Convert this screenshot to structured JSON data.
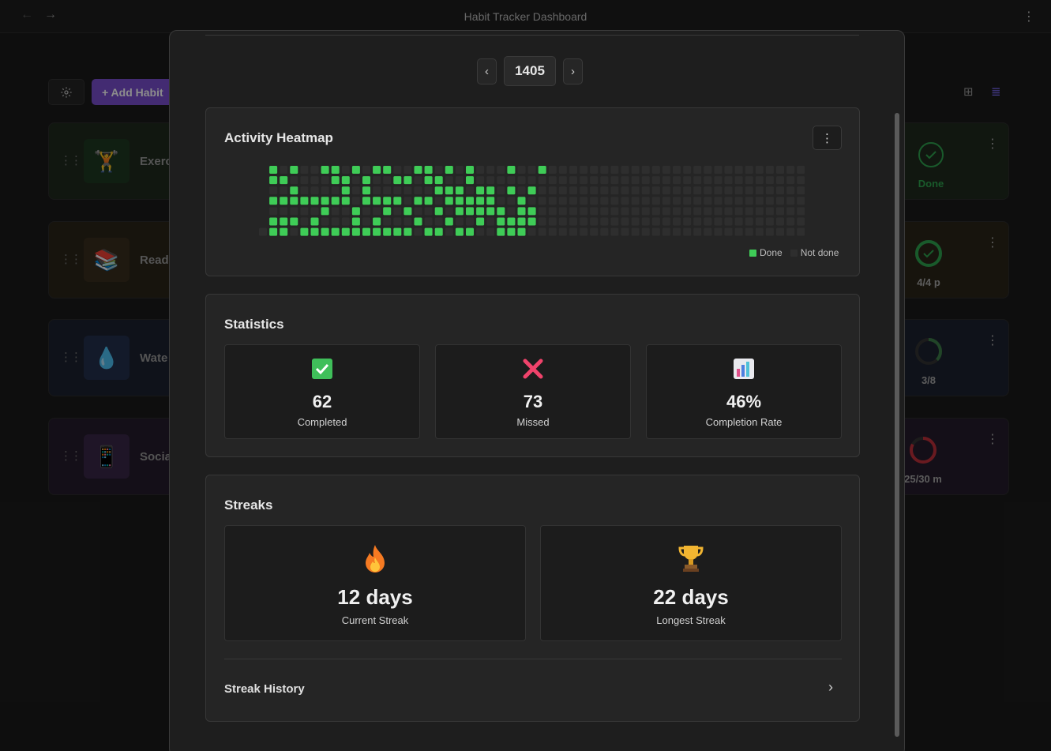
{
  "window": {
    "title": "Habit Tracker Dashboard",
    "back_icon": "arrow-left-icon",
    "forward_icon": "arrow-right-icon",
    "menu_icon": "vertical-dots-icon"
  },
  "toolbar": {
    "settings_icon": "gear-icon",
    "add_label": "+ Add Habit",
    "view_grid_icon": "grid-icon",
    "view_list_icon": "list-icon"
  },
  "habits": [
    {
      "name": "Exerc",
      "emoji": "🏋️",
      "status": "Done",
      "status_color": "#2fa44f",
      "tint": "#1f2a1e"
    },
    {
      "name": "Readi",
      "emoji": "📚",
      "status": "4/4 p",
      "status_color": "#2fa44f",
      "tint": "#2a2519"
    },
    {
      "name": "Wate",
      "emoji": "💧",
      "status": "3/8",
      "status_color": "#3d7f4a",
      "tint": "#1d2130",
      "progress": 0.375
    },
    {
      "name": "Socia",
      "emoji": "📱",
      "status": "25/30 m",
      "status_color": "#c0313b",
      "tint": "#261d2c",
      "progress": 0.83
    }
  ],
  "modal": {
    "year": "1405",
    "prev_label": "‹",
    "next_label": "›",
    "heatmap": {
      "title": "Activity Heatmap",
      "menu_icon": "vertical-dots-icon",
      "legend_done": "Done",
      "legend_not_done": "Not done",
      "done_color": "#3fcc57",
      "empty_color": "#2e2e2e",
      "weeks": 53,
      "done_cells": [
        [
          1,
          0
        ],
        [
          2,
          1
        ],
        [
          3,
          0
        ],
        [
          4,
          3
        ],
        [
          5,
          5
        ],
        [
          6,
          0
        ],
        [
          7,
          0
        ],
        [
          8,
          1
        ],
        [
          9,
          4
        ],
        [
          10,
          2
        ],
        [
          11,
          6
        ],
        [
          12,
          4
        ],
        [
          13,
          1
        ],
        [
          14,
          4
        ],
        [
          15,
          5
        ],
        [
          16,
          0
        ],
        [
          17,
          2
        ],
        [
          18,
          2
        ],
        [
          19,
          3
        ],
        [
          20,
          1
        ],
        [
          21,
          5
        ],
        [
          22,
          3
        ],
        [
          23,
          6
        ],
        [
          24,
          2
        ],
        [
          25,
          4
        ],
        [
          26,
          2
        ],
        [
          27,
          0
        ],
        [
          1,
          1
        ],
        [
          2,
          3
        ],
        [
          3,
          5
        ],
        [
          5,
          3
        ],
        [
          6,
          6
        ],
        [
          7,
          3
        ],
        [
          8,
          3
        ],
        [
          9,
          5
        ],
        [
          10,
          1
        ],
        [
          11,
          0
        ],
        [
          11,
          5
        ],
        [
          12,
          3
        ],
        [
          13,
          6
        ],
        [
          14,
          1
        ],
        [
          15,
          3
        ],
        [
          16,
          6
        ],
        [
          17,
          1
        ],
        [
          18,
          0
        ],
        [
          19,
          6
        ],
        [
          20,
          4
        ],
        [
          21,
          3
        ],
        [
          22,
          2
        ],
        [
          23,
          4
        ],
        [
          24,
          5
        ],
        [
          25,
          6
        ],
        [
          26,
          5
        ],
        [
          1,
          3
        ],
        [
          2,
          5
        ],
        [
          4,
          6
        ],
        [
          6,
          3
        ],
        [
          7,
          1
        ],
        [
          8,
          2
        ],
        [
          8,
          6
        ],
        [
          9,
          0
        ],
        [
          10,
          6
        ],
        [
          11,
          3
        ],
        [
          12,
          0
        ],
        [
          13,
          3
        ],
        [
          14,
          6
        ],
        [
          15,
          0
        ],
        [
          17,
          4
        ],
        [
          18,
          3
        ],
        [
          19,
          2
        ],
        [
          20,
          0
        ],
        [
          21,
          2
        ],
        [
          22,
          4
        ],
        [
          24,
          0
        ],
        [
          25,
          3
        ],
        [
          26,
          4
        ],
        [
          1,
          5
        ],
        [
          1,
          6
        ],
        [
          2,
          6
        ],
        [
          3,
          2
        ],
        [
          5,
          6
        ],
        [
          6,
          4
        ],
        [
          7,
          6
        ],
        [
          9,
          6
        ],
        [
          12,
          6
        ],
        [
          16,
          1
        ],
        [
          17,
          6
        ],
        [
          18,
          5
        ],
        [
          19,
          4
        ],
        [
          20,
          6
        ],
        [
          21,
          4
        ],
        [
          23,
          5
        ],
        [
          24,
          6
        ],
        [
          25,
          5
        ],
        [
          16,
          3
        ],
        [
          10,
          3
        ],
        [
          20,
          3
        ],
        [
          4,
          3
        ],
        [
          3,
          3
        ]
      ]
    },
    "statistics": {
      "title": "Statistics",
      "cards": [
        {
          "icon": "check-icon",
          "value": "62",
          "label": "Completed"
        },
        {
          "icon": "cross-icon",
          "value": "73",
          "label": "Missed"
        },
        {
          "icon": "bar-chart-icon",
          "value": "46%",
          "label": "Completion Rate"
        }
      ]
    },
    "streaks": {
      "title": "Streaks",
      "current": {
        "icon": "fire-icon",
        "value": "12 days",
        "label": "Current Streak"
      },
      "longest": {
        "icon": "trophy-icon",
        "value": "22 days",
        "label": "Longest Streak"
      },
      "history_label": "Streak History",
      "history_icon": "chevron-right-icon"
    }
  }
}
